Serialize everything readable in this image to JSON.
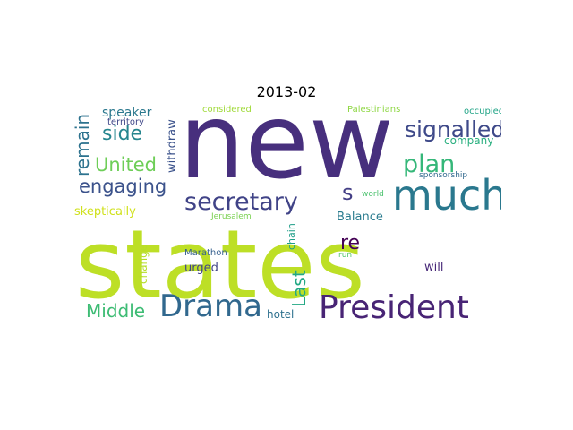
{
  "title": "2013-02",
  "words": [
    {
      "text": "states",
      "color": "#bddf26"
    },
    {
      "text": "new",
      "color": "#472f7d"
    },
    {
      "text": "much",
      "color": "#2a788e"
    },
    {
      "text": "President",
      "color": "#482475"
    },
    {
      "text": "Drama",
      "color": "#31688e"
    },
    {
      "text": "secretary",
      "color": "#404387"
    },
    {
      "text": "signalled",
      "color": "#3e4989"
    },
    {
      "text": "plan",
      "color": "#35b779"
    },
    {
      "text": "side",
      "color": "#25858e"
    },
    {
      "text": "United",
      "color": "#6ece58"
    },
    {
      "text": "engaging",
      "color": "#3b528b"
    },
    {
      "text": "remain",
      "color": "#2c728e"
    },
    {
      "text": "Middle",
      "color": "#3dbc74"
    },
    {
      "text": "Last",
      "color": "#22a884"
    },
    {
      "text": "re",
      "color": "#440154"
    },
    {
      "text": "s",
      "color": "#433e85"
    },
    {
      "text": "speaker",
      "color": "#2a788e"
    },
    {
      "text": "withdraw",
      "color": "#3b528b"
    },
    {
      "text": "company",
      "color": "#29af7f"
    },
    {
      "text": "skeptically",
      "color": "#d0e11c"
    },
    {
      "text": "Balance",
      "color": "#297b8e"
    },
    {
      "text": "urged",
      "color": "#414487"
    },
    {
      "text": "will",
      "color": "#482878"
    },
    {
      "text": "change",
      "color": "#b5de2b"
    },
    {
      "text": "hotel",
      "color": "#2d708e"
    },
    {
      "text": "chain",
      "color": "#1f9e89"
    },
    {
      "text": "Marathon",
      "color": "#355f8d"
    },
    {
      "text": "Jerusalem",
      "color": "#7ad151"
    },
    {
      "text": "territory",
      "color": "#3f4788"
    },
    {
      "text": "considered",
      "color": "#a0da39"
    },
    {
      "text": "Palestinians",
      "color": "#8fd744"
    },
    {
      "text": "occupied",
      "color": "#20a486"
    },
    {
      "text": "sponsorship",
      "color": "#31688e"
    },
    {
      "text": "world",
      "color": "#4ac16d"
    },
    {
      "text": "run",
      "color": "#52c569"
    }
  ]
}
